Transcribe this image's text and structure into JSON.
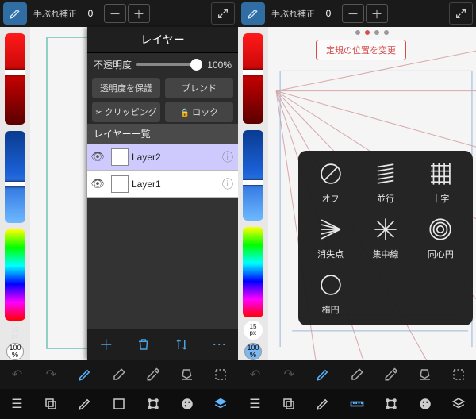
{
  "topbar": {
    "stabilizer_label": "手ぶれ補正",
    "stabilizer_value": "0",
    "minus": "－",
    "plus": "＋"
  },
  "left_panel": {
    "size_badge": "15\npx",
    "opacity_badge": "100\n%"
  },
  "layer_panel": {
    "title": "レイヤー",
    "opacity_label": "不透明度",
    "opacity_value": "100%",
    "protect_alpha": "透明度を保護",
    "blend": "ブレンド",
    "clipping": "クリッピング",
    "lock": "ロック",
    "list_header": "レイヤー一覧",
    "layers": [
      {
        "name": "Layer2",
        "selected": true
      },
      {
        "name": "Layer1",
        "selected": false
      }
    ]
  },
  "screen2": {
    "change_ruler": "定規の位置を変更"
  },
  "ruler_popup": {
    "items": [
      "オフ",
      "並行",
      "十字",
      "消失点",
      "集中線",
      "同心円",
      "楕円"
    ]
  }
}
